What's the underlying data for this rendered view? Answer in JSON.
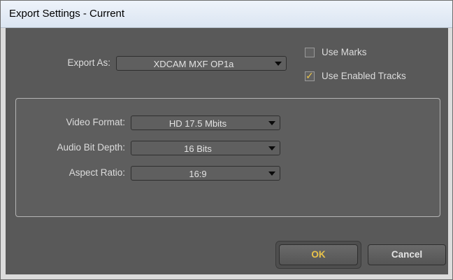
{
  "window": {
    "title": "Export Settings - Current"
  },
  "export_as": {
    "label": "Export As:",
    "value": "XDCAM MXF OP1a"
  },
  "options": {
    "use_marks": {
      "label": "Use Marks",
      "checked": false
    },
    "use_enabled_tracks": {
      "label": "Use Enabled Tracks",
      "checked": true
    }
  },
  "settings": {
    "video_format": {
      "label": "Video Format:",
      "value": "HD 17.5 Mbits"
    },
    "audio_bit_depth": {
      "label": "Audio Bit Depth:",
      "value": "16 Bits"
    },
    "aspect_ratio": {
      "label": "Aspect Ratio:",
      "value": "16:9"
    }
  },
  "buttons": {
    "ok_label": "OK",
    "cancel_label": "Cancel"
  },
  "colors": {
    "background": "#595959",
    "accent_ok": "#e8c24a",
    "text": "#dcdcdc",
    "checkmark": "#e8c24a"
  },
  "icons": {
    "dropdown": "dropdown-arrow-icon",
    "check": "checkmark-icon"
  }
}
